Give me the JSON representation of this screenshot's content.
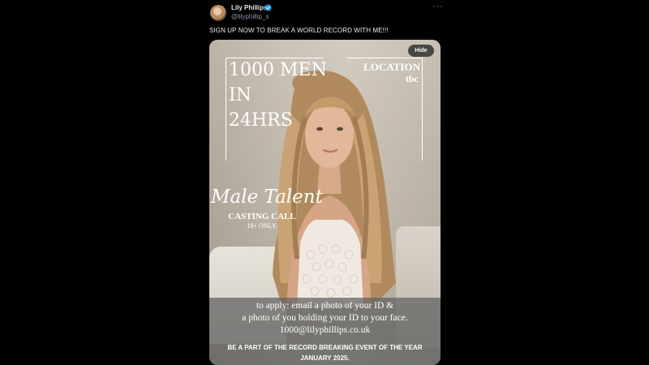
{
  "author": {
    "display_name": "Lily Phillips",
    "handle": "@lilyphillip_s"
  },
  "post": {
    "text": "SIGN UP NOW TO BREAK A WORLD RECORD WITH ME!!!"
  },
  "media": {
    "hide_label": "Hide",
    "headline": [
      "1000 MEN",
      "IN",
      "24HRS"
    ],
    "location_title": "LOCATION",
    "location_value": "tbc",
    "talent_script": "Male Talent",
    "casting": "CASTING CALL",
    "age_note": "18+ ONLY.",
    "apply_lines": [
      "to apply: email a photo of your ID &",
      "a photo of you holding your ID to your face.",
      "1000@lilyphillips.co.uk"
    ],
    "promo_lines": [
      "BE A PART OF THE RECORD BREAKING EVENT OF THE YEAR",
      "JANUARY 2025."
    ]
  },
  "icons": {
    "verified": "verified-badge-icon",
    "more": "more-options-icon",
    "accent": "#1d9bf0"
  }
}
